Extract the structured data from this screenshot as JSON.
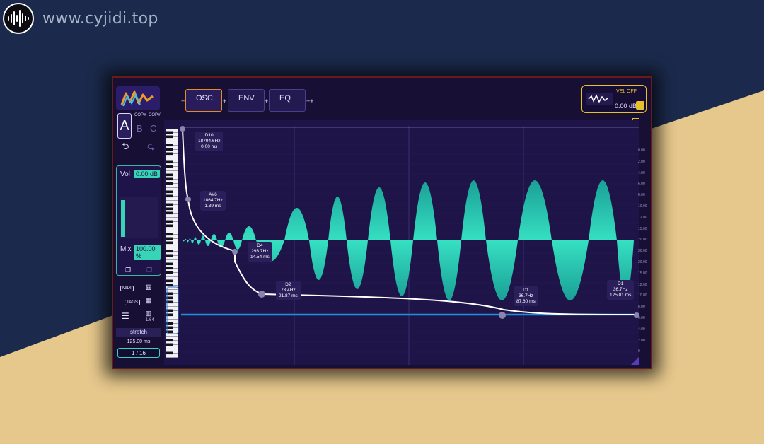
{
  "site": {
    "watermark": "www.cyjidi.top",
    "logo_icon": "soundwave-icon"
  },
  "colors": {
    "accent": "#38d4b8",
    "wave": "#27c9b0",
    "curve": "#ffffff",
    "blue_line": "#1f8fe0",
    "highlight": "#e8c02a",
    "active_tab": "#e38a2a"
  },
  "sidebar": {
    "copy_a": "COPY",
    "copy_b": "COPY",
    "slot_a": "A",
    "slot_b": "B",
    "slot_c": "C",
    "vol_label": "Vol",
    "vol_value": "0.00 dB",
    "mix_label": "Mix",
    "mix_value": "100.00 %",
    "midi_label": "MIDI",
    "tags_label": "TAGS",
    "grid_label": "1/64",
    "stretch_label": "stretch",
    "stretch_value": "125.00 ms",
    "division": "1 / 16"
  },
  "tabs": [
    {
      "label": "OSC",
      "active": true
    },
    {
      "label": "ENV",
      "active": false
    },
    {
      "label": "EQ",
      "active": false
    }
  ],
  "plus_signs": {
    "p1": "+",
    "p2": "+",
    "p3": "+",
    "p4": "++"
  },
  "output": {
    "vel_label": "VEL OFF",
    "gain": "0.00 dB"
  },
  "p_button": "P",
  "points": [
    {
      "note": "D10",
      "freq": "18794.6Hz",
      "time": "0.00 ms"
    },
    {
      "note": "A#6",
      "freq": "1864.7Hz",
      "time": "1.39 ms"
    },
    {
      "note": "D4",
      "freq": "293.7Hz",
      "time": "14.54 ms"
    },
    {
      "note": "D2",
      "freq": "73.4Hz",
      "time": "21.87 ms"
    },
    {
      "note": "D1",
      "freq": "36.7Hz",
      "time": "87.60 ms"
    },
    {
      "note": "D1",
      "freq": "36.7Hz",
      "time": "125.01 ms"
    }
  ],
  "scale_labels": [
    "0.00",
    "2.00",
    "4.00",
    "6.00",
    "8.00",
    "10.00",
    "12.00",
    "15.00",
    "20.00",
    "30.00",
    "20.00",
    "15.00",
    "12.00",
    "10.00",
    "8.00",
    "6.00",
    "4.00",
    "2.00",
    "0"
  ]
}
